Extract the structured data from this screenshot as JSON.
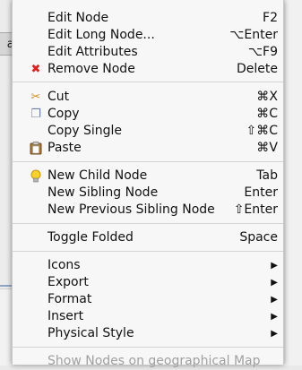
{
  "background": {
    "node_fragment": "ar"
  },
  "menu": {
    "items": [
      {
        "label": "Edit Node",
        "shortcut": "F2",
        "icon": ""
      },
      {
        "label": "Edit Long Node...",
        "shortcut": "⌥Enter",
        "icon": ""
      },
      {
        "label": "Edit Attributes",
        "shortcut": "⌥F9",
        "icon": ""
      },
      {
        "label": "Remove Node",
        "shortcut": "Delete",
        "icon": "remove-icon"
      },
      {
        "label": "Cut",
        "shortcut": "⌘X",
        "icon": "scissors-icon"
      },
      {
        "label": "Copy",
        "shortcut": "⌘C",
        "icon": "copy-icon"
      },
      {
        "label": "Copy Single",
        "shortcut": "⇧⌘C",
        "icon": ""
      },
      {
        "label": "Paste",
        "shortcut": "⌘V",
        "icon": "paste-icon"
      },
      {
        "label": "New Child Node",
        "shortcut": "Tab",
        "icon": "lightbulb-icon"
      },
      {
        "label": "New Sibling Node",
        "shortcut": "Enter",
        "icon": ""
      },
      {
        "label": "New Previous Sibling Node",
        "shortcut": "⇧Enter",
        "icon": ""
      },
      {
        "label": "Toggle Folded",
        "shortcut": "Space",
        "icon": ""
      },
      {
        "label": "Icons",
        "submenu": true
      },
      {
        "label": "Export",
        "submenu": true
      },
      {
        "label": "Format",
        "submenu": true
      },
      {
        "label": "Insert",
        "submenu": true
      },
      {
        "label": "Physical Style",
        "submenu": true
      },
      {
        "label": "Show Nodes on geographical Map",
        "disabled": true
      }
    ],
    "submenu_arrow": "▶",
    "icon_glyphs": {
      "remove": "✖",
      "cut": "✂",
      "copy": "❐",
      "paste": "📋",
      "bulb": "💡"
    }
  }
}
